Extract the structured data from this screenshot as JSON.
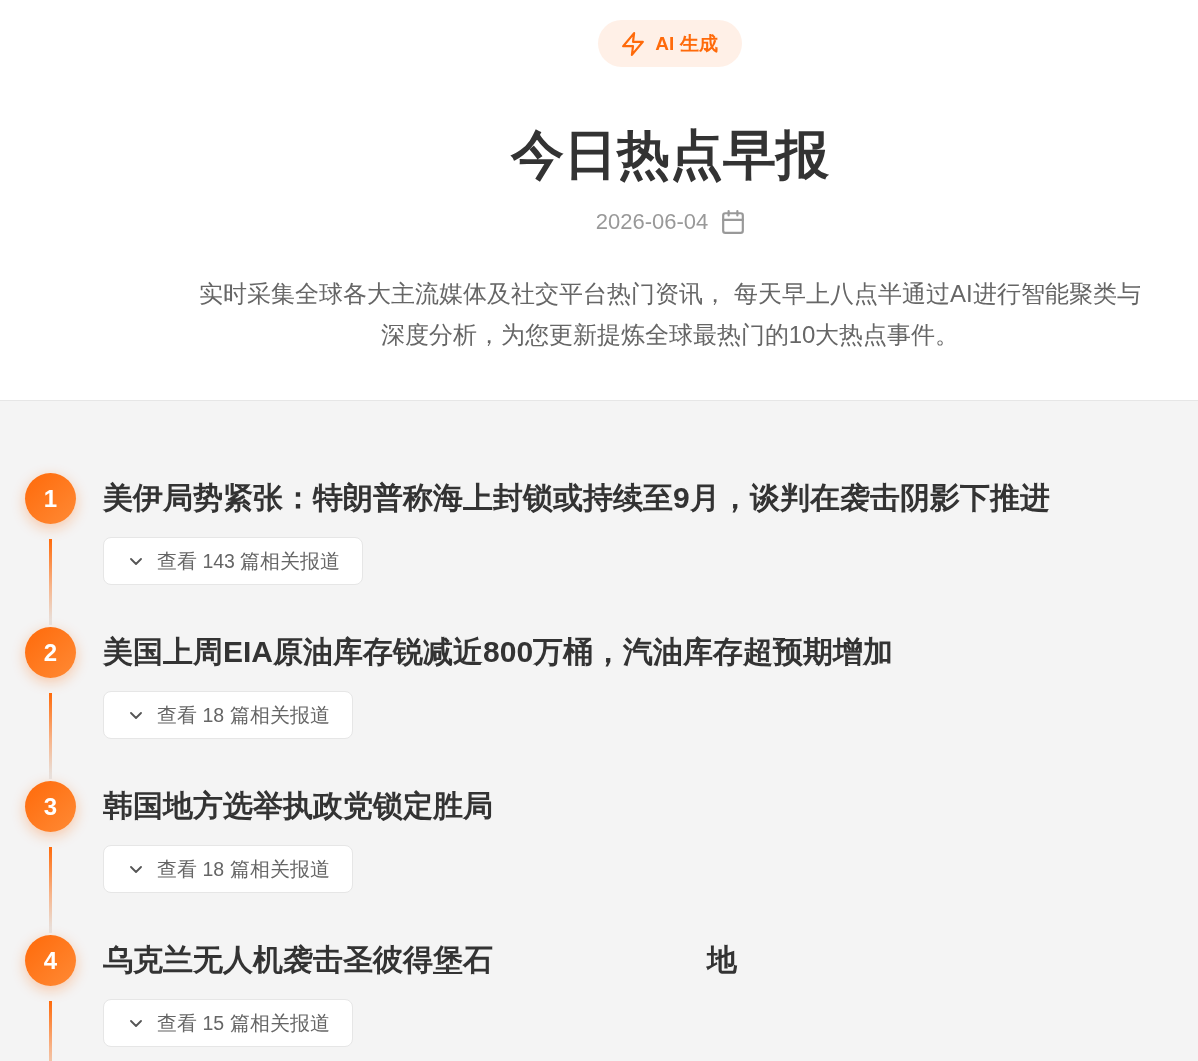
{
  "badge": {
    "label": "AI 生成"
  },
  "header": {
    "title": "今日热点早报",
    "date": "2026-06-04",
    "description": "实时采集全球各大主流媒体及社交平台热门资讯， 每天早上八点半通过AI进行智能聚类与深度分析，为您更新提炼全球最热门的10大热点事件。"
  },
  "news": [
    {
      "rank": "1",
      "title": "美伊局势紧张：特朗普称海上封锁或持续至9月，谈判在袭击阴影下推进",
      "reports_label": "查看 143 篇相关报道",
      "expanded": false
    },
    {
      "rank": "2",
      "title": "美国上周EIA原油库存锐减近800万桶，汽油库存超预期增加",
      "reports_label": "查看 18 篇相关报道",
      "expanded": false
    },
    {
      "rank": "3",
      "title": "韩国地方选举执政党锁定胜局",
      "reports_label": "查看 18 篇相关报道",
      "expanded": false
    },
    {
      "rank": "4",
      "title": "乌克兰无人机袭击圣彼得堡石",
      "title_tail": "地",
      "reports_label": "查看 15 篇相关报道",
      "expanded": false
    }
  ]
}
